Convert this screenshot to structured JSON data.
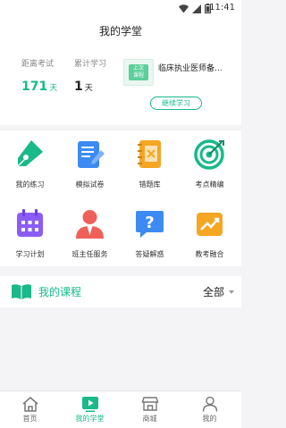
{
  "status_bar": {
    "time": "11:41",
    "icons": [
      "wifi-icon",
      "signal-icon",
      "battery-icon"
    ]
  },
  "header": {
    "title": "我的学堂"
  },
  "stats": {
    "exam_countdown": {
      "label": "距离考试",
      "value": "171",
      "unit": "天"
    },
    "study_days": {
      "label": "累计学习",
      "value": "1",
      "unit": "天"
    }
  },
  "last_course": {
    "tag_line1": "上次",
    "tag_line2": "课程",
    "name": "临床执业医师备...",
    "continue_label": "继续学习"
  },
  "features": [
    {
      "label": "我的练习",
      "icon": "pen-icon"
    },
    {
      "label": "模拟试卷",
      "icon": "paper-icon"
    },
    {
      "label": "错题库",
      "icon": "wrong-book-icon"
    },
    {
      "label": "考点精编",
      "icon": "target-icon"
    },
    {
      "label": "学习计划",
      "icon": "calendar-icon"
    },
    {
      "label": "班主任服务",
      "icon": "teacher-icon"
    },
    {
      "label": "答疑解惑",
      "icon": "question-icon"
    },
    {
      "label": "教考融合",
      "icon": "chart-icon"
    }
  ],
  "my_courses": {
    "title": "我的课程",
    "filter": "全部"
  },
  "tabs": [
    {
      "label": "首页",
      "icon": "home-icon",
      "active": false
    },
    {
      "label": "我的学堂",
      "icon": "play-icon",
      "active": true
    },
    {
      "label": "商城",
      "icon": "store-icon",
      "active": false
    },
    {
      "label": "我的",
      "icon": "user-icon",
      "active": false
    }
  ],
  "colors": {
    "accent": "#19b98a",
    "blue": "#3d8bf2",
    "orange": "#f5a623",
    "purple": "#8b5cf6",
    "red": "#f0605a"
  }
}
